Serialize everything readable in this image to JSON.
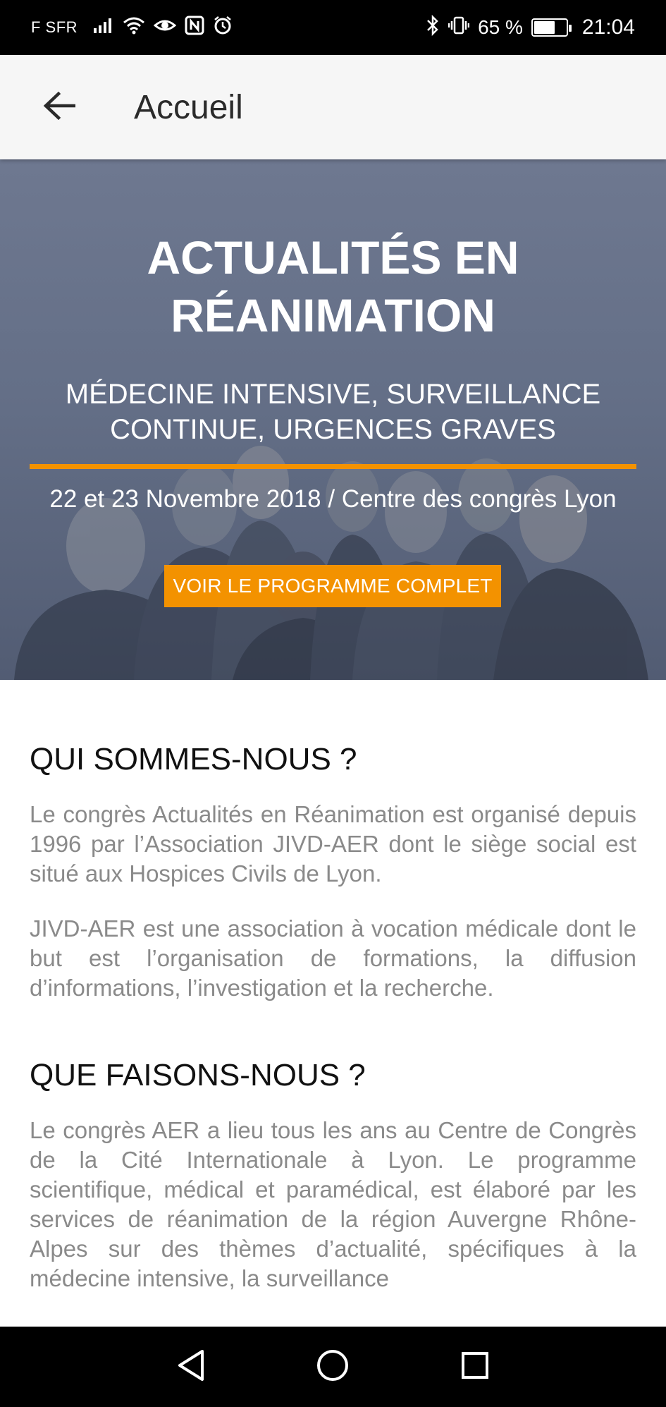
{
  "status_bar": {
    "carrier": "F SFR",
    "battery_percent": "65 %",
    "battery_level": 0.65,
    "time": "21:04",
    "icons": [
      "signal-icon",
      "wifi-icon",
      "eye-icon",
      "nfc-icon",
      "alarm-icon",
      "bluetooth-icon",
      "vibrate-icon",
      "battery-icon"
    ]
  },
  "app_bar": {
    "title": "Accueil",
    "back_icon": "arrow-left-icon"
  },
  "hero": {
    "title_line1": "ACTUALITÉS EN",
    "title_line2": "RÉANIMATION",
    "subtitle_line1": "MÉDECINE INTENSIVE, SURVEILLANCE",
    "subtitle_line2": "CONTINUE, URGENCES GRAVES",
    "date_location": "22 et 23 Novembre 2018 / Centre des congrès Lyon",
    "button_label": "VOIR LE PROGRAMME COMPLET",
    "accent_color": "#f39200"
  },
  "sections": [
    {
      "heading": "QUI SOMMES-NOUS ?",
      "paragraphs": [
        "Le congrès Actualités en Réanimation est organisé depuis 1996 par l’Association JIVD-AER dont le siège social est situé aux Hospices Civils de Lyon.",
        "JIVD-AER est une association à vocation médicale dont le but est l’organisation de formations, la diffusion d’informations, l’investigation et la recherche."
      ]
    },
    {
      "heading": "QUE FAISONS-NOUS ?",
      "paragraphs": [
        "Le congrès AER a lieu tous les ans au Centre de Congrès de la Cité Internationale à Lyon. Le programme scientifique, médical et paramédical, est élaboré par les services de réanimation de la région Auvergne Rhône-Alpes sur des thèmes d’actualité, spécifiques à la médecine intensive, la surveillance"
      ]
    }
  ],
  "nav_bar": {
    "icons": [
      "back-triangle-icon",
      "home-circle-icon",
      "recents-square-icon"
    ]
  }
}
